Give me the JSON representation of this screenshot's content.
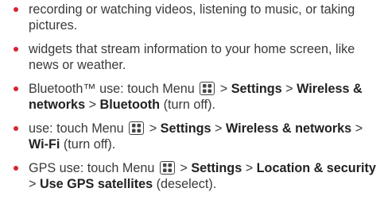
{
  "theme": {
    "bullet_color": "#d9232e",
    "text_color": "#3a3a3a"
  },
  "icons": {
    "menu_key": "menu-key-icon"
  },
  "items": [
    {
      "text": "recording or watching videos, listening to music, or taking pictures."
    },
    {
      "text": "widgets that stream information to your home screen, like news or weather."
    },
    {
      "prefix": "Bluetooth™ use: touch Menu",
      "gt1": ">",
      "settings": "Settings",
      "gt2": ">",
      "wireless": "Wireless & networks",
      "gt3": ">",
      "target": "Bluetooth",
      "suffix": "(turn off)."
    },
    {
      "prefix": "use: touch Menu",
      "gt1": ">",
      "settings": "Settings",
      "gt2": ">",
      "wireless": "Wireless & networks",
      "gt3": ">",
      "target": "Wi-Fi",
      "suffix": "(turn off)."
    },
    {
      "prefix": "GPS use: touch Menu",
      "gt1": ">",
      "settings": "Settings",
      "gt2": ">",
      "location": "Location & security",
      "gt3": ">",
      "target": "Use GPS satellites",
      "suffix": "(deselect)."
    }
  ]
}
